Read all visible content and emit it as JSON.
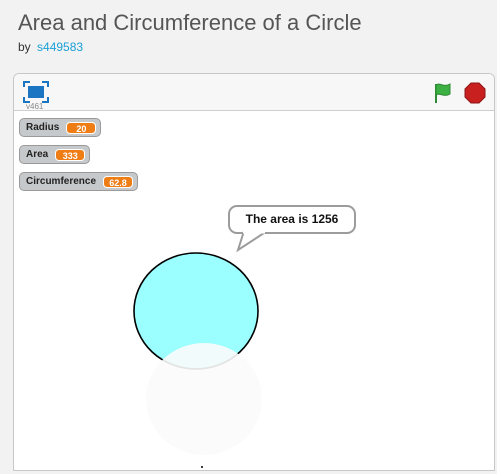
{
  "header": {
    "title": "Area and Circumference of a Circle",
    "by_label": "by",
    "author": "s449583"
  },
  "player": {
    "version": "v461",
    "icons": {
      "fullscreen": "fullscreen-icon",
      "green_flag": "green-flag-icon",
      "stop": "stop-sign-icon"
    },
    "colors": {
      "flag": "#3cb043",
      "stop": "#c8201f",
      "fullscreen": "#1b75c3"
    }
  },
  "stage": {
    "monitors": [
      {
        "label": "Radius",
        "value": "20"
      },
      {
        "label": "Area",
        "value": "333"
      },
      {
        "label": "Circumference",
        "value": "62.8"
      }
    ],
    "speech_bubble": "The area is 1256",
    "circle_fill": "#9bffff",
    "monitor_value_color": "#ee7d16"
  }
}
